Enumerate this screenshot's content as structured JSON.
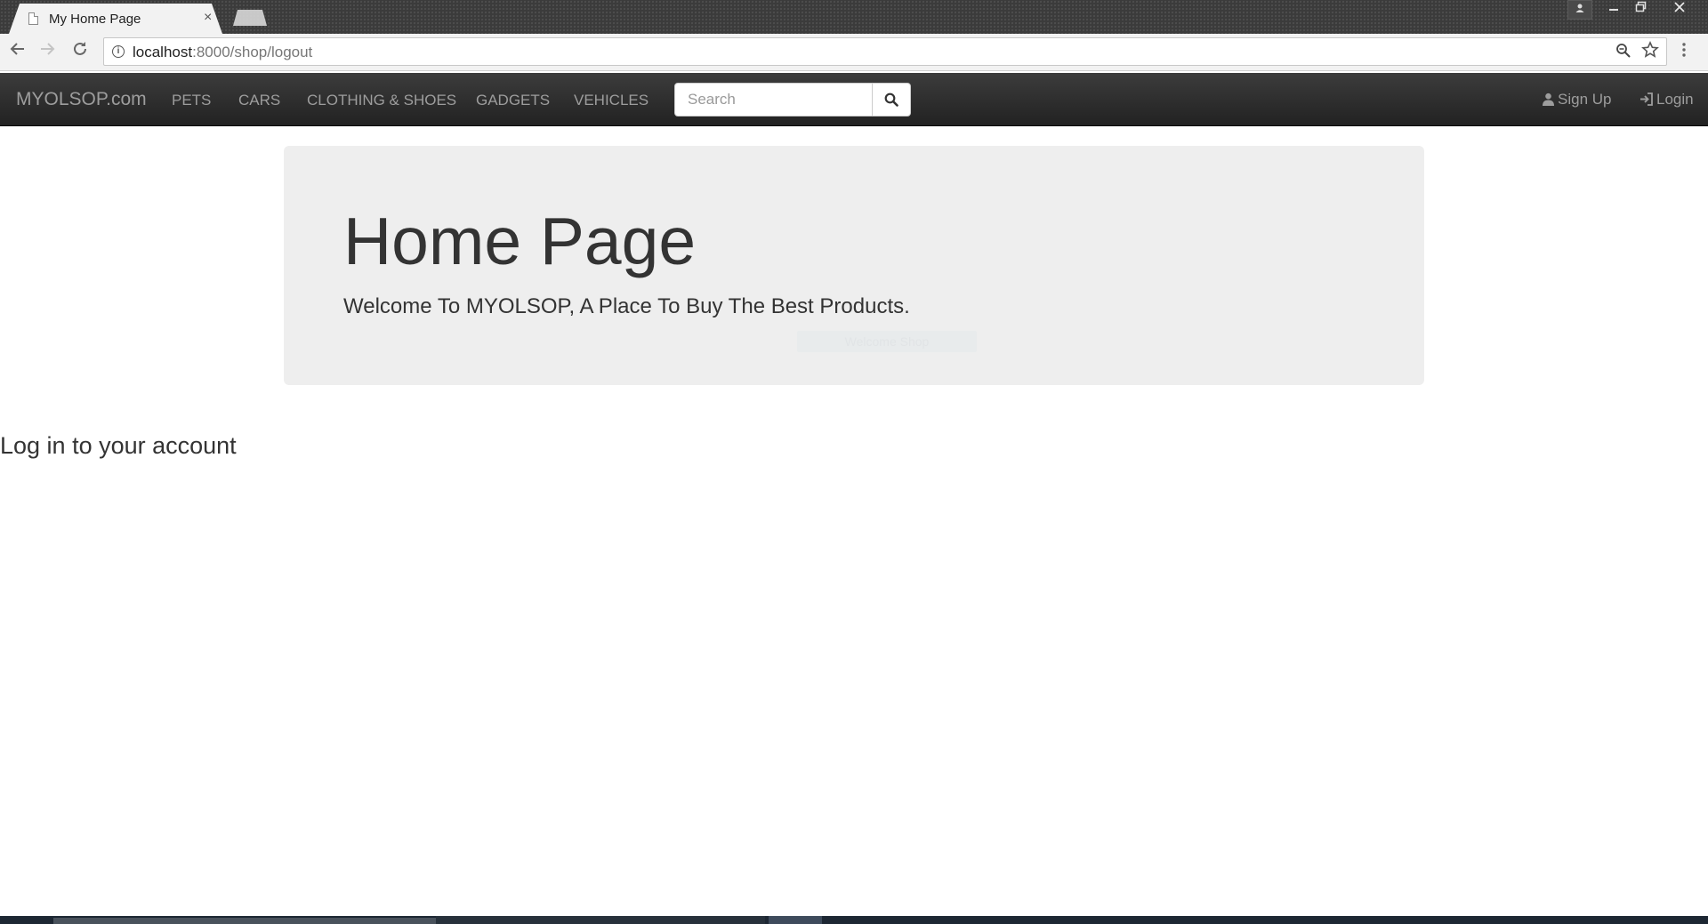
{
  "browser": {
    "tab_title": "My Home Page",
    "tab_close_glyph": "×",
    "url_host": "localhost",
    "url_path": ":8000/shop/logout",
    "icons": [
      "document-icon",
      "info-icon",
      "zoom-icon",
      "star-icon",
      "menu-icon",
      "back-arrow-icon",
      "forward-arrow-icon",
      "reload-icon"
    ]
  },
  "navbar": {
    "brand": "MYOLSOP.com",
    "links": [
      {
        "label": "PETS"
      },
      {
        "label": "CARS"
      },
      {
        "label": "CLOTHING & SHOES"
      },
      {
        "label": "GADGETS"
      },
      {
        "label": "VEHICLES"
      }
    ],
    "search_placeholder": "Search",
    "signup_label": "Sign Up",
    "login_label": "Login"
  },
  "jumbotron": {
    "title": "Home Page",
    "subtitle": "Welcome To MYOLSOP, A Place To Buy The Best Products.",
    "faint_button_text": "Welcome Shop"
  },
  "main": {
    "heading": "Log in to your account"
  },
  "colors": {
    "navbar_bg": "#222222",
    "navbar_text": "#9d9d9d",
    "jumbotron_bg": "#eeeeee",
    "text": "#333333"
  }
}
